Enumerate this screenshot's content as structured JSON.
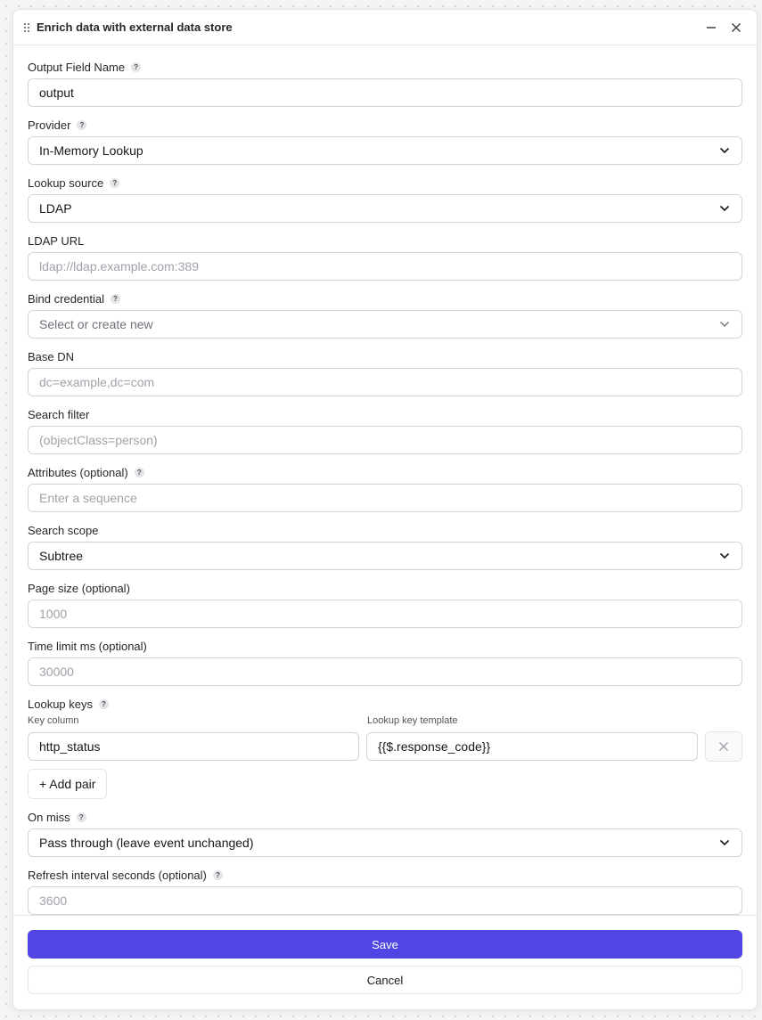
{
  "window": {
    "title": "Enrich data with external data store",
    "minimize_icon": "minus-icon",
    "close_icon": "close-icon",
    "drag_icon": "grip-icon"
  },
  "help_glyph": "?",
  "fields": {
    "output_field_name": {
      "label": "Output Field Name",
      "value": "output"
    },
    "provider": {
      "label": "Provider",
      "value": "In-Memory Lookup"
    },
    "lookup_source": {
      "label": "Lookup source",
      "value": "LDAP"
    },
    "ldap_url": {
      "label": "LDAP URL",
      "placeholder": "ldap://ldap.example.com:389"
    },
    "bind_credential": {
      "label": "Bind credential",
      "placeholder": "Select or create new"
    },
    "base_dn": {
      "label": "Base DN",
      "placeholder": "dc=example,dc=com"
    },
    "search_filter": {
      "label": "Search filter",
      "placeholder": "(objectClass=person)"
    },
    "attributes": {
      "label": "Attributes (optional)",
      "placeholder": "Enter a sequence"
    },
    "search_scope": {
      "label": "Search scope",
      "value": "Subtree"
    },
    "page_size": {
      "label": "Page size (optional)",
      "placeholder": "1000"
    },
    "time_limit": {
      "label": "Time limit ms (optional)",
      "placeholder": "30000"
    },
    "lookup_keys": {
      "label": "Lookup keys",
      "key_column_label": "Key column",
      "template_label": "Lookup key template",
      "rows": [
        {
          "key_column": "http_status",
          "template": "{{$.response_code}}"
        }
      ],
      "add_pair_label": "+ Add pair"
    },
    "on_miss": {
      "label": "On miss",
      "value": "Pass through (leave event unchanged)"
    },
    "refresh_interval": {
      "label": "Refresh interval seconds (optional)",
      "placeholder": "3600"
    }
  },
  "footer": {
    "save_label": "Save",
    "cancel_label": "Cancel"
  },
  "colors": {
    "primary": "#4f46e5",
    "border": "#d4d4d8",
    "background": "#f4f4f5"
  }
}
